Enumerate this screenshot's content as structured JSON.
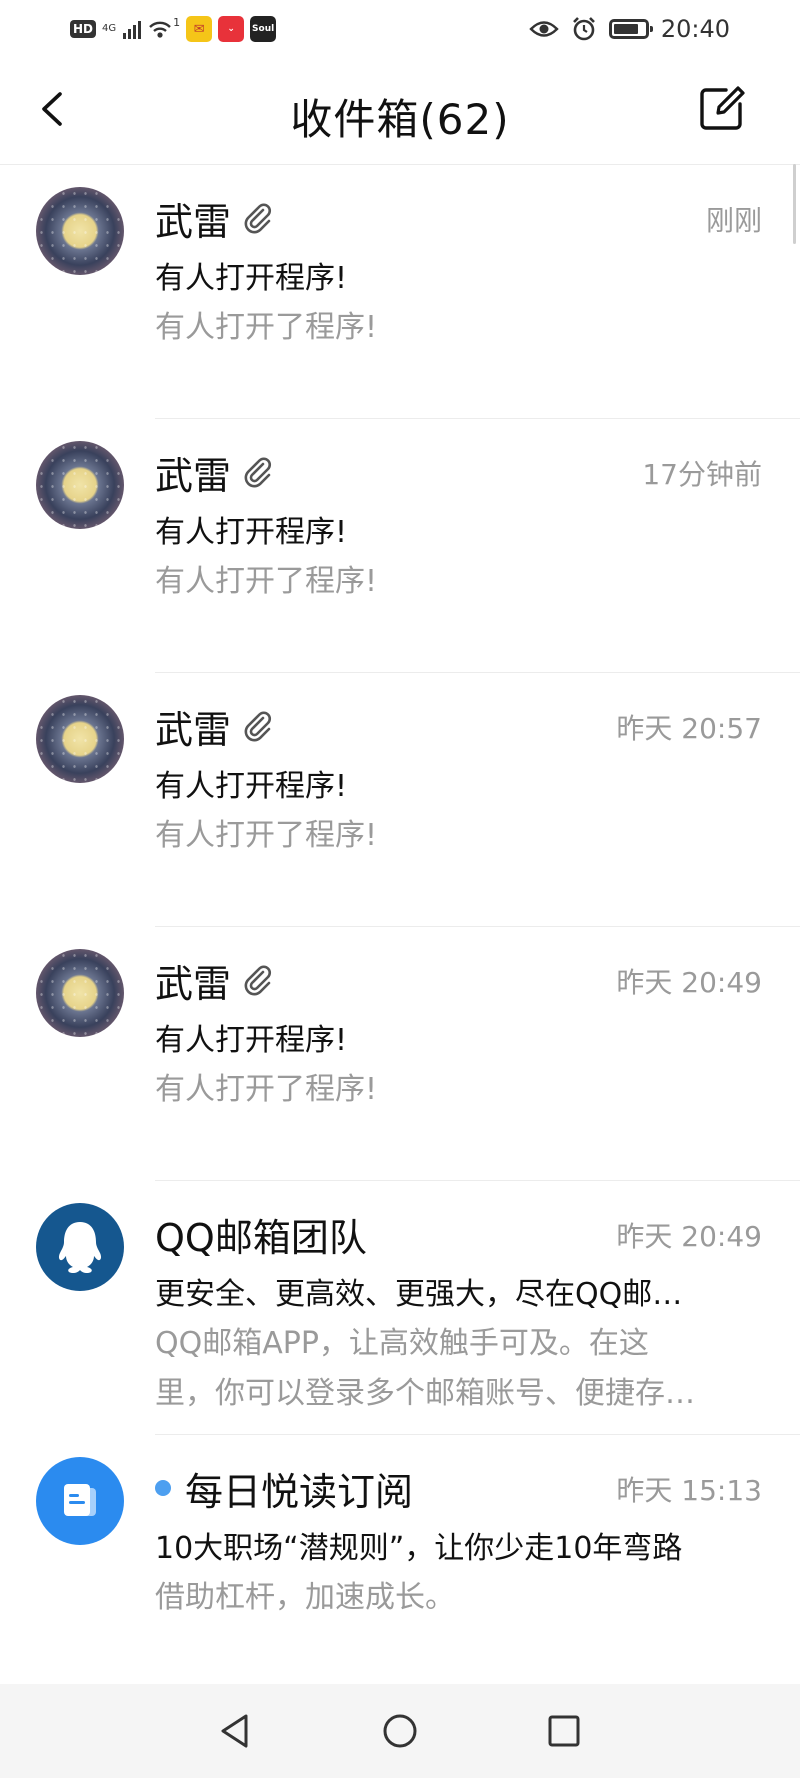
{
  "status_bar": {
    "hd": "HD",
    "network": "4G",
    "wifi_badge": "1",
    "apps": [
      "Soul"
    ],
    "time": "20:40",
    "icons": [
      "eye-icon",
      "alarm-icon",
      "battery-icon"
    ]
  },
  "header": {
    "title": "收件箱(62)",
    "back_icon": "chevron-left-icon",
    "compose_icon": "compose-icon"
  },
  "mails": [
    {
      "sender": "武雷",
      "attachment": true,
      "time": "刚刚",
      "subject": "有人打开程序!",
      "preview": "有人打开了程序!",
      "avatar": "moon"
    },
    {
      "sender": "武雷",
      "attachment": true,
      "time": "17分钟前",
      "subject": "有人打开程序!",
      "preview": "有人打开了程序!",
      "avatar": "moon"
    },
    {
      "sender": "武雷",
      "attachment": true,
      "time": "昨天 20:57",
      "subject": "有人打开程序!",
      "preview": "有人打开了程序!",
      "avatar": "moon"
    },
    {
      "sender": "武雷",
      "attachment": true,
      "time": "昨天 20:49",
      "subject": "有人打开程序!",
      "preview": "有人打开了程序!",
      "avatar": "moon"
    },
    {
      "sender": "QQ邮箱团队",
      "attachment": false,
      "time": "昨天 20:49",
      "subject": "更安全、更高效、更强大，尽在QQ邮…",
      "preview_line1": "QQ邮箱APP，让高效触手可及。在这",
      "preview_line2": "里，你可以登录多个邮箱账号、便捷存…",
      "avatar": "qq"
    },
    {
      "sender": "每日悦读订阅",
      "attachment": false,
      "unread": true,
      "time": "昨天 15:13",
      "subject": "10大职场“潜规则”，让你少走10年弯路",
      "preview": "借助杠杆，加速成长。",
      "avatar": "subscription"
    }
  ],
  "colors": {
    "unread_dot": "#4d9ff0",
    "qq_avatar": "#15578f",
    "sub_avatar": "#2b8bef",
    "muted_text": "#9a9a9a"
  }
}
